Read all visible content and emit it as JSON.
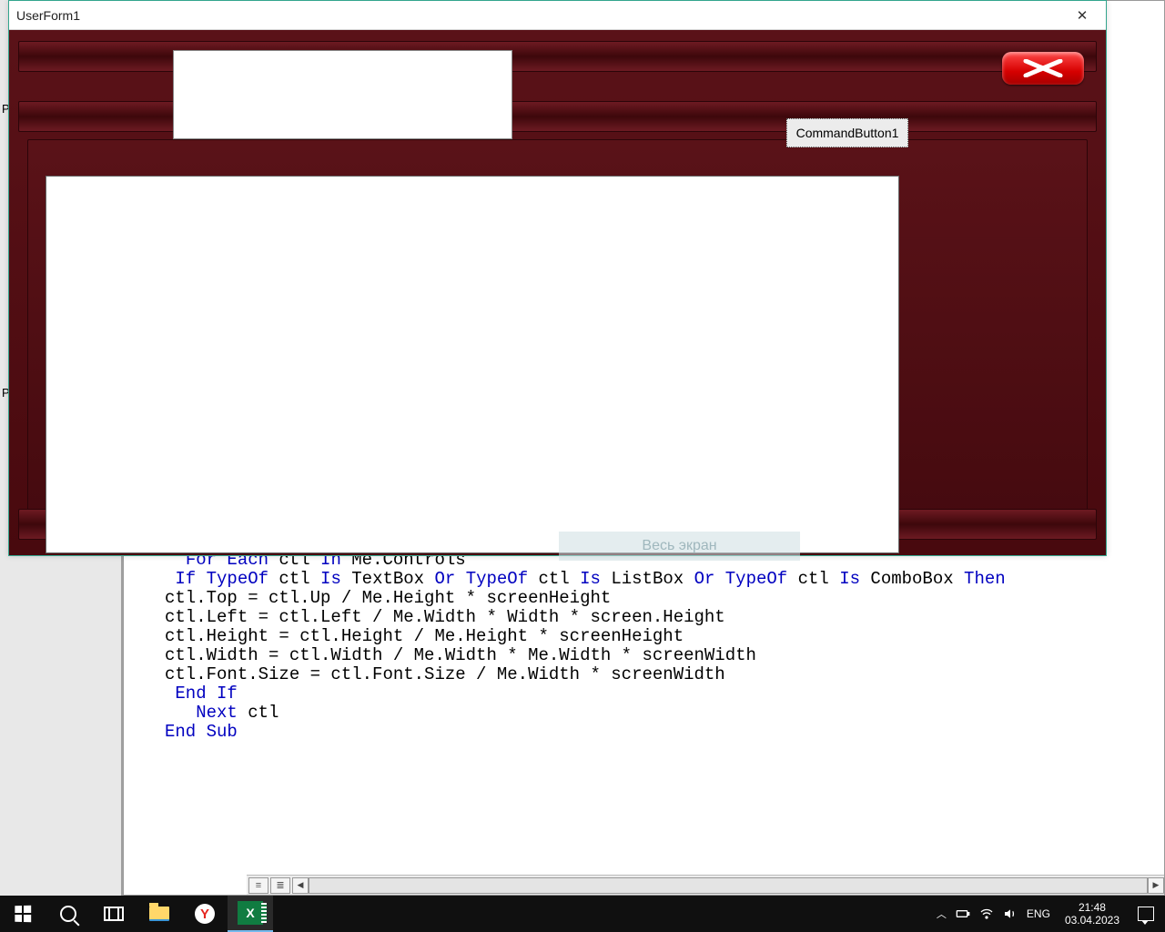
{
  "background_labels": {
    "p1": "P",
    "p2": "P"
  },
  "code": {
    "l1a": "For Each",
    "l1b": " ctl ",
    "l1c": "In",
    "l1d": " Me.Controls",
    "l2a": " If TypeOf",
    "l2b": " ctl ",
    "l2c": "Is",
    "l2d": " TextBox ",
    "l2e": "Or TypeOf",
    "l2f": " ctl ",
    "l2g": "Is",
    "l2h": " ListBox ",
    "l2i": "Or TypeOf",
    "l2j": " ctl ",
    "l2k": "Is",
    "l2l": " ComboBox ",
    "l2m": "Then",
    "l3": "ctl.Top = ctl.Up / Me.Height * screenHeight",
    "l4": "ctl.Left = ctl.Left / Me.Width * Width * screen.Height",
    "l5": "ctl.Height = ctl.Height / Me.Height * screenHeight",
    "l6": "ctl.Width = ctl.Width / Me.Width * Me.Width * screenWidth",
    "l7": "ctl.Font.Size = ctl.Font.Size / Me.Width * screenWidth",
    "l8": " End If",
    "l9a": "   Next",
    "l9b": " ctl",
    "l10": "End Sub"
  },
  "userform": {
    "title": "UserForm1",
    "command_button_label": "CommandButton1",
    "ghost_label": "Весь экран"
  },
  "taskbar": {
    "lang": "ENG",
    "time": "21:48",
    "date": "03.04.2023"
  }
}
